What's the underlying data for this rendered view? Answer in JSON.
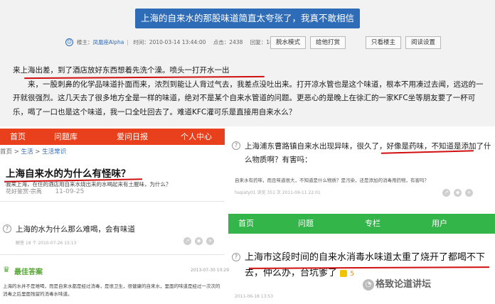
{
  "forum": {
    "thread_title": "上海的自来水的那股味道简直太夸张了，我真不敢相信",
    "author_label": "楼主：",
    "author": "凤凰座Alpha",
    "posted": "时间：2010-03-14 13:44:00",
    "views": "点击：2438",
    "replies": "回复：18",
    "buttons": [
      "脱水模式",
      "给他打赏",
      "只看楼主",
      "阅读设置"
    ],
    "body_line1": "来上海出差，到了酒店放好东西想着先洗个澡。喷头一打开水一出",
    "body_rest": "来，一股刺鼻的化学品味道扑面而来，浓烈到能让人背过气去，我差点没吐出来。打开凉水管也是这个味道，根本不用凑过去闻，远远的一开就很强烈。这几天去了很多地方全是一样的味道，绝对不是某个自来水管道的问题。更恶心的是晚上在徐汇的一家KFC坐等朋友要了一杯可乐，喝了一口也是这个味道，我一口全吐回去了。难道KFC灌可乐是直接用自来水么？"
  },
  "qa_left": {
    "nav": [
      "首页",
      "问题库",
      "爱问日报",
      "个人中心"
    ],
    "crumb_home": "首页",
    "crumb_1": "生活",
    "crumb_2": "生活常识",
    "q1_title": "上海自来水的为什么有怪味？",
    "q1_desc": "我来上海，在住的酒店用自来水烧出来的水喝起来有土腥味，为什么？",
    "q1_user": "花好鉴赏-宗禹",
    "q1_date": "11-09-25",
    "q2_title": "上海的水为什么那么难喝，会有味道",
    "q2_meta": "解答 18 个   2010-07-26 15:13",
    "best_label": "最佳答案",
    "best_date": "2013-07-30 10:29",
    "best_body": "上海的水并不是难喝，而是自来水都是经过消毒，是很卫生，很健康的自来水，里面的味道是经过一次次的消毒之后里面残留的消毒水味道。"
  },
  "qa_right_1": {
    "title": "上海浦东曹路镇自来水出现异味，很久了，好像是药味，不知道是添加了什么物质啊？有害吗：",
    "desc": "自来水有药味，而且味道很大，不知道是什么物质？是污染，还是添加的消毒用药物，有害吗？",
    "meta": "hsqiaty01      浏览 351 次      2011-09-11 22:01"
  },
  "qa_right_2": {
    "nav": [
      "首页",
      "问题",
      "专栏",
      "用户"
    ],
    "title": "上海市这段时间的自来水消毒水味道太重了烧开了都喝不下去，仲么办，台坑爹了",
    "reward": "5",
    "meta": "2011-06-18 13:53"
  },
  "watermark": "格致论道讲坛"
}
